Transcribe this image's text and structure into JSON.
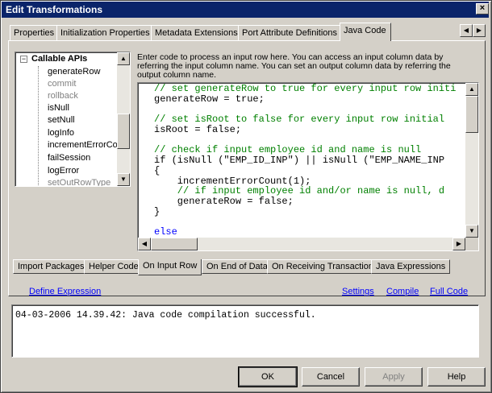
{
  "window": {
    "title": "Edit Transformations",
    "close_glyph": "×"
  },
  "tabs": [
    {
      "label": "Properties"
    },
    {
      "label": "Initialization Properties"
    },
    {
      "label": "Metadata Extensions"
    },
    {
      "label": "Port Attribute Definitions"
    },
    {
      "label": "Java Code"
    }
  ],
  "tree": {
    "root_label": "Callable APIs",
    "items": [
      {
        "label": "generateRow",
        "enabled": true
      },
      {
        "label": "commit",
        "enabled": false
      },
      {
        "label": "rollback",
        "enabled": false
      },
      {
        "label": "isNull",
        "enabled": true
      },
      {
        "label": "setNull",
        "enabled": true
      },
      {
        "label": "logInfo",
        "enabled": true
      },
      {
        "label": "incrementErrorCou",
        "enabled": true
      },
      {
        "label": "failSession",
        "enabled": true
      },
      {
        "label": "logError",
        "enabled": true
      },
      {
        "label": "setOutRowType",
        "enabled": false
      }
    ]
  },
  "editor": {
    "instructions": "Enter code to process an input row here. You can access an input column data by referring the input column name. You can set an output column data by referring the output column name.",
    "lines": [
      "// set generateRow to true for every input row initi",
      "generateRow = true;",
      "",
      "// set isRoot to false for every input row initial",
      "isRoot = false;",
      "",
      "// check if input employee id and name is null",
      "if (isNull (\"EMP_ID_INP\") || isNull (\"EMP_NAME_INP",
      "{",
      "    incrementErrorCount(1);",
      "    // if input employee id and/or name is null, d",
      "    generateRow = false;",
      "}",
      "",
      "else"
    ]
  },
  "bottom_tabs": [
    {
      "label": "Import Packages"
    },
    {
      "label": "Helper Code"
    },
    {
      "label": "On Input Row"
    },
    {
      "label": "On End of Data"
    },
    {
      "label": "On Receiving Transaction"
    },
    {
      "label": "Java Expressions"
    }
  ],
  "links": {
    "define_expression": "Define Expression",
    "settings": "Settings",
    "compile": "Compile",
    "full_code": "Full Code"
  },
  "output": {
    "message": "04-03-2006 14.39.42: Java code compilation successful."
  },
  "buttons": {
    "ok": "OK",
    "cancel": "Cancel",
    "apply": "Apply",
    "help": "Help"
  }
}
